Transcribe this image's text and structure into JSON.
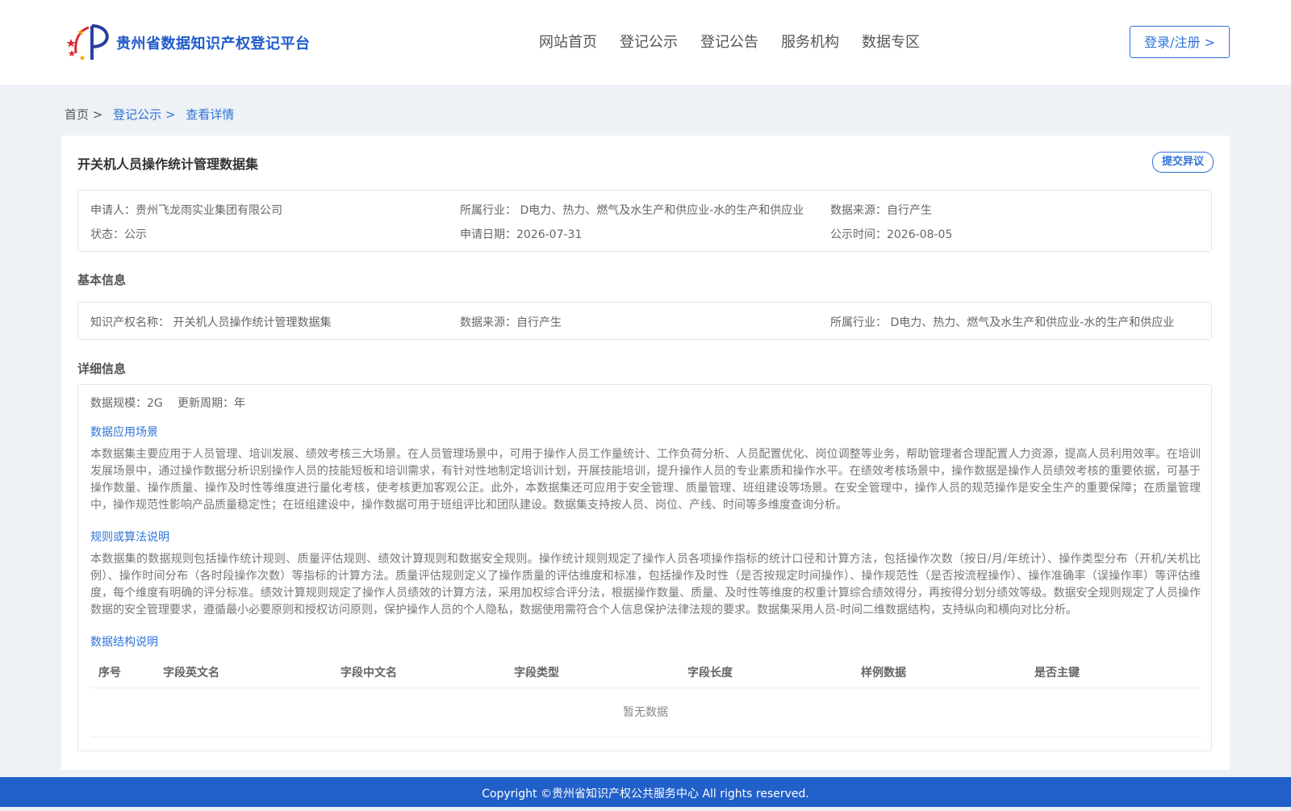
{
  "header": {
    "site_title": "贵州省数据知识产权登记平台",
    "nav": [
      "网站首页",
      "登记公示",
      "登记公告",
      "服务机构",
      "数据专区"
    ],
    "login_label": "登录/注册 >"
  },
  "breadcrumb": {
    "home": "首页 >",
    "list": "登记公示 >",
    "current": "查看详情"
  },
  "dataset": {
    "title": "开关机人员操作统计管理数据集",
    "objection_label": "提交异议"
  },
  "summary": {
    "applicant": "申请人：贵州飞龙雨实业集团有限公司",
    "industry": "所属行业： D电力、热力、燃气及水生产和供应业-水的生产和供应业",
    "source": "数据来源：自行产生",
    "status": "状态：公示",
    "apply_date": "申请日期：2026-07-31",
    "publish_date": "公示时间：2026-08-05"
  },
  "basic": {
    "section_title": "基本信息",
    "ip_name": "知识产权名称： 开关机人员操作统计管理数据集",
    "source": "数据来源：自行产生",
    "industry": "所属行业： D电力、热力、燃气及水生产和供应业-水的生产和供应业"
  },
  "detail": {
    "section_title": "详细信息",
    "scale": "数据规模：2G",
    "cycle": "更新周期：年",
    "scenario_title": "数据应用场景",
    "scenario_text": "本数据集主要应用于人员管理、培训发展、绩效考核三大场景。在人员管理场景中，可用于操作人员工作量统计、工作负荷分析、人员配置优化、岗位调整等业务，帮助管理者合理配置人力资源，提高人员利用效率。在培训发展场景中，通过操作数据分析识别操作人员的技能短板和培训需求，有针对性地制定培训计划，开展技能培训，提升操作人员的专业素质和操作水平。在绩效考核场景中，操作数据是操作人员绩效考核的重要依据，可基于操作数量、操作质量、操作及时性等维度进行量化考核，使考核更加客观公正。此外，本数据集还可应用于安全管理、质量管理、班组建设等场景。在安全管理中，操作人员的规范操作是安全生产的重要保障；在质量管理中，操作规范性影响产品质量稳定性；在班组建设中，操作数据可用于班组评比和团队建设。数据集支持按人员、岗位、产线、时间等多维度查询分析。",
    "rules_title": "规则或算法说明",
    "rules_text": "本数据集的数据规则包括操作统计规则、质量评估规则、绩效计算规则和数据安全规则。操作统计规则规定了操作人员各项操作指标的统计口径和计算方法，包括操作次数（按日/月/年统计）、操作类型分布（开机/关机比例）、操作时间分布（各时段操作次数）等指标的计算方法。质量评估规则定义了操作质量的评估维度和标准，包括操作及时性（是否按规定时间操作）、操作规范性（是否按流程操作）、操作准确率（误操作率）等评估维度，每个维度有明确的评分标准。绩效计算规则规定了操作人员绩效的计算方法，采用加权综合评分法，根据操作数量、质量、及时性等维度的权重计算综合绩效得分，再按得分划分绩效等级。数据安全规则规定了人员操作数据的安全管理要求，遵循最小必要原则和授权访问原则，保护操作人员的个人隐私，数据使用需符合个人信息保护法律法规的要求。数据集采用人员-时间二维数据结构，支持纵向和横向对比分析。",
    "structure_title": "数据结构说明",
    "table_headers": [
      "序号",
      "字段英文名",
      "字段中文名",
      "字段类型",
      "字段长度",
      "样例数据",
      "是否主键"
    ],
    "empty_text": "暂无数据"
  },
  "footer": {
    "text": "Copyright ©贵州省知识产权公共服务中心 All rights reserved."
  },
  "colors": {
    "accent": "#2e73d9",
    "footer_bg": "#2260c9",
    "page_bg": "#eef1f5"
  }
}
